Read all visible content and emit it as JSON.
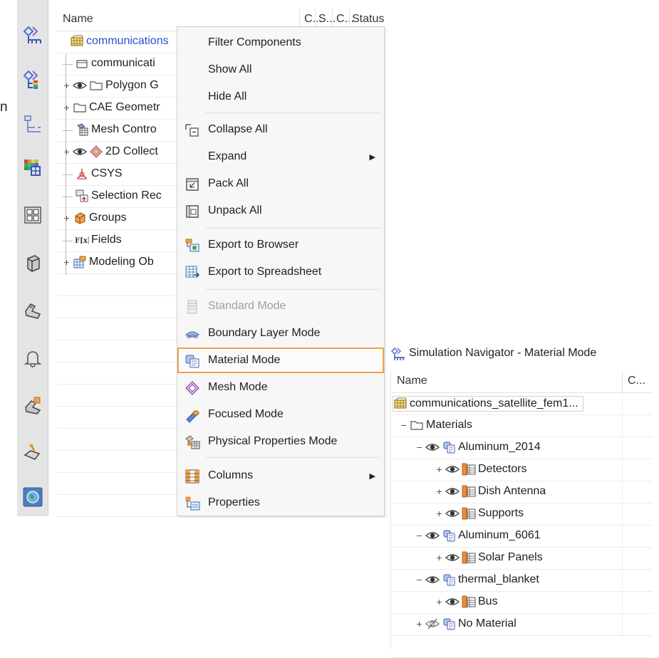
{
  "nav": {
    "columns": [
      "Name",
      "C...",
      "S...",
      "C...",
      "Status"
    ],
    "rows": [
      {
        "label": "communications",
        "icon": "fem-root-icon",
        "indent": 0,
        "expander": "",
        "eye": false
      },
      {
        "label": "communicati",
        "icon": "fem-file-icon",
        "indent": 1,
        "expander": "",
        "eye": false
      },
      {
        "label": "Polygon G",
        "icon": "folder-icon",
        "indent": 1,
        "expander": "+",
        "eye": true
      },
      {
        "label": "CAE Geometr",
        "icon": "folder-icon",
        "indent": 1,
        "expander": "+",
        "eye": false
      },
      {
        "label": "Mesh Contro",
        "icon": "mesh-controls-icon",
        "indent": 1,
        "expander": "",
        "eye": false
      },
      {
        "label": "2D Collect",
        "icon": "2d-collector-icon",
        "indent": 1,
        "expander": "+",
        "eye": true
      },
      {
        "label": "CSYS",
        "icon": "csys-icon",
        "indent": 1,
        "expander": "",
        "eye": false
      },
      {
        "label": "Selection Rec",
        "icon": "selection-recipe-icon",
        "indent": 1,
        "expander": "",
        "eye": false
      },
      {
        "label": "Groups",
        "icon": "groups-icon",
        "indent": 1,
        "expander": "+",
        "eye": false
      },
      {
        "label": "Fields",
        "icon": "fields-icon",
        "indent": 1,
        "expander": "",
        "eye": false
      },
      {
        "label": "Modeling Ob",
        "icon": "modeling-objects-icon",
        "indent": 1,
        "expander": "+",
        "eye": false
      }
    ]
  },
  "menu": {
    "items": [
      {
        "label": "Filter Components",
        "icon": "",
        "disabled": false
      },
      {
        "label": "Show All",
        "icon": "",
        "disabled": false
      },
      {
        "label": "Hide All",
        "icon": "",
        "disabled": false
      },
      {
        "label": "Collapse All",
        "icon": "collapse-all-icon",
        "disabled": false
      },
      {
        "label": "Expand",
        "icon": "",
        "disabled": false,
        "submenu": true
      },
      {
        "label": "Pack All",
        "icon": "pack-all-icon",
        "disabled": false
      },
      {
        "label": "Unpack All",
        "icon": "unpack-all-icon",
        "disabled": false
      },
      {
        "label": "Export to Browser",
        "icon": "export-browser-icon",
        "disabled": false
      },
      {
        "label": "Export to Spreadsheet",
        "icon": "export-spreadsheet-icon",
        "disabled": false
      },
      {
        "label": "Standard Mode",
        "icon": "standard-mode-icon",
        "disabled": true
      },
      {
        "label": "Boundary Layer Mode",
        "icon": "boundary-layer-icon",
        "disabled": false
      },
      {
        "label": "Material Mode",
        "icon": "material-mode-icon",
        "disabled": false,
        "highlight": true
      },
      {
        "label": "Mesh Mode",
        "icon": "mesh-mode-icon",
        "disabled": false
      },
      {
        "label": "Focused Mode",
        "icon": "focused-mode-icon",
        "disabled": false
      },
      {
        "label": "Physical Properties Mode",
        "icon": "physical-properties-icon",
        "disabled": false
      },
      {
        "label": "Columns",
        "icon": "columns-icon",
        "disabled": false,
        "submenu": true
      },
      {
        "label": "Properties",
        "icon": "properties-icon",
        "disabled": false
      }
    ],
    "highlight_color": "#f0a24a"
  },
  "material_nav": {
    "title": "Simulation Navigator - Material Mode",
    "columns": [
      "Name",
      "C..."
    ],
    "rows": [
      {
        "label": "communications_satellite_fem1...",
        "icon": "fem-root-icon",
        "indent": 0,
        "expander": "",
        "eye": "",
        "selected": true
      },
      {
        "label": "Materials",
        "icon": "folder-icon",
        "indent": 1,
        "expander": "−",
        "eye": ""
      },
      {
        "label": "Aluminum_2014",
        "icon": "material-icon",
        "indent": 2,
        "expander": "−",
        "eye": "eye"
      },
      {
        "label": "Detectors",
        "icon": "physical-property-icon",
        "indent": 3,
        "expander": "+",
        "eye": "eye"
      },
      {
        "label": "Dish Antenna",
        "icon": "physical-property-icon",
        "indent": 3,
        "expander": "+",
        "eye": "eye"
      },
      {
        "label": "Supports",
        "icon": "physical-property-icon",
        "indent": 3,
        "expander": "+",
        "eye": "eye"
      },
      {
        "label": "Aluminum_6061",
        "icon": "material-icon",
        "indent": 2,
        "expander": "−",
        "eye": "eye"
      },
      {
        "label": "Solar Panels",
        "icon": "physical-property-icon",
        "indent": 3,
        "expander": "+",
        "eye": "eye"
      },
      {
        "label": "thermal_blanket",
        "icon": "material-icon",
        "indent": 2,
        "expander": "−",
        "eye": "eye"
      },
      {
        "label": "Bus",
        "icon": "physical-property-icon",
        "indent": 3,
        "expander": "+",
        "eye": "eye"
      },
      {
        "label": "No Material",
        "icon": "material-icon",
        "indent": 2,
        "expander": "+",
        "eye": "eye-hidden"
      }
    ]
  },
  "toolbar": {
    "icons": [
      "simulation-navigator-icon",
      "results-navigator-icon",
      "graph-icon",
      "color-legend-icon",
      "layout-icon",
      "part-icon",
      "bracket-icon",
      "bell-icon",
      "assembly-icon",
      "inspect-icon",
      "globe-icon"
    ]
  },
  "stray_char": "n"
}
